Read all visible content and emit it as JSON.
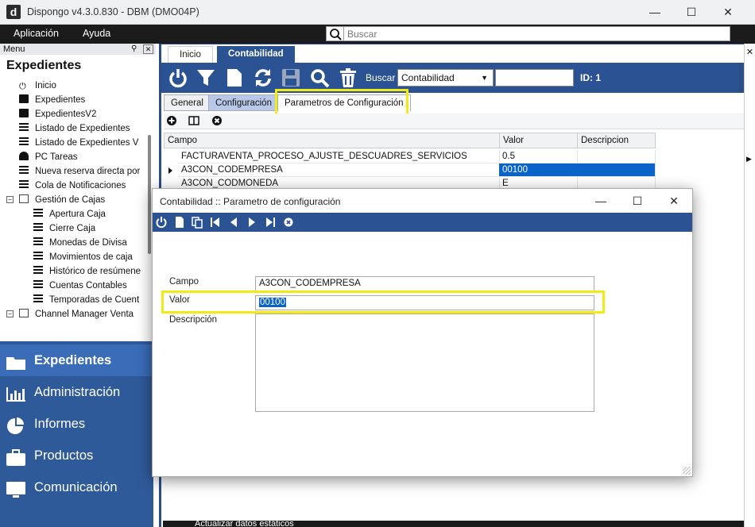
{
  "window": {
    "logo": "d",
    "title": "Dispongo v4.3.0.830 - DBM (DMO04P)",
    "minimize": "—",
    "maximize": "☐",
    "close": "✕"
  },
  "menubar": {
    "items": [
      "Aplicación",
      "Ayuda"
    ],
    "search_placeholder": "Buscar"
  },
  "left_panel": {
    "header": "Menu",
    "title": "Expedientes",
    "tree": [
      {
        "label": "Inicio",
        "icon": "power-icon"
      },
      {
        "label": "Expedientes",
        "icon": "folder-icon"
      },
      {
        "label": "ExpedientesV2",
        "icon": "folder-icon"
      },
      {
        "label": "Listado de Expedientes",
        "icon": "table-icon"
      },
      {
        "label": "Listado de Expedientes V",
        "icon": "table-icon"
      },
      {
        "label": "PC Tareas",
        "icon": "bell-icon"
      },
      {
        "label": "Nueva reserva directa por",
        "icon": "list-icon"
      },
      {
        "label": "Cola de Notificaciones",
        "icon": "table-icon"
      },
      {
        "label": "Gestión de Cajas",
        "icon": "folder-open-icon"
      },
      {
        "label": "Apertura Caja",
        "icon": "list-icon"
      },
      {
        "label": "Cierre Caja",
        "icon": "list-icon"
      },
      {
        "label": "Monedas de Divisa",
        "icon": "list-icon"
      },
      {
        "label": "Movimientos de caja",
        "icon": "list-icon"
      },
      {
        "label": "Histórico de resúmene",
        "icon": "list-icon"
      },
      {
        "label": "Cuentas Contables",
        "icon": "list-icon"
      },
      {
        "label": "Temporadas de Cuent",
        "icon": "list-icon"
      },
      {
        "label": "Channel Manager Venta",
        "icon": "folder-open-icon"
      }
    ],
    "nav": [
      {
        "label": "Expedientes",
        "icon": "folder-icon"
      },
      {
        "label": "Administración",
        "icon": "bar-chart-icon"
      },
      {
        "label": "Informes",
        "icon": "pie-chart-icon"
      },
      {
        "label": "Productos",
        "icon": "briefcase-icon"
      },
      {
        "label": "Comunicación",
        "icon": "monitor-icon"
      }
    ]
  },
  "main": {
    "tabs": [
      "Inicio",
      "Contabilidad"
    ],
    "buscar_label": "Buscar",
    "buscar_select": "Contabilidad",
    "id_label": "ID: 1",
    "subtabs": [
      "General",
      "Configuración",
      "Parametros de Configuración"
    ],
    "grid": {
      "columns": [
        "Campo",
        "Valor",
        "Descripcion"
      ],
      "rows": [
        {
          "campo": "FACTURAVENTA_PROCESO_AJUSTE_DESCUADRES_SERVICIOS",
          "valor": "0.5",
          "descripcion": ""
        },
        {
          "campo": "A3CON_CODEMPRESA",
          "valor": "00100",
          "descripcion": ""
        },
        {
          "campo": "A3CON_CODMONEDA",
          "valor": "E",
          "descripcion": ""
        }
      ]
    },
    "bottom_text": "Actualizar datos estáticos"
  },
  "dialog": {
    "title": "Contabilidad :: Parametro de configuración",
    "fields": {
      "campo_label": "Campo",
      "campo_value": "A3CON_CODEMPRESA",
      "valor_label": "Valor",
      "valor_value": "00100",
      "descripcion_label": "Descripción",
      "descripcion_value": ""
    }
  },
  "colors": {
    "accent": "#2b5394",
    "highlight": "#f2ea10",
    "selection": "#0a63c9"
  }
}
